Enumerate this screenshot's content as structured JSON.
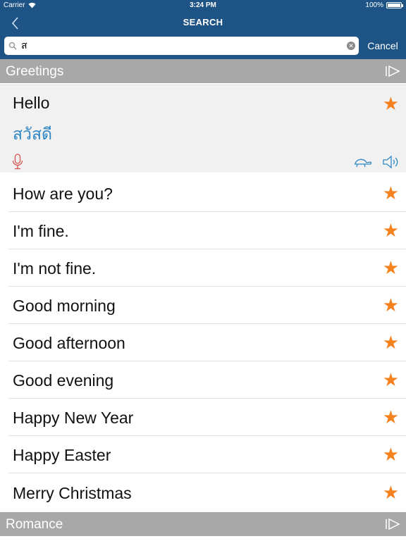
{
  "status": {
    "carrier": "Carrier",
    "time": "3:24 PM",
    "battery": "100%"
  },
  "nav": {
    "title": "SEARCH",
    "back_icon": "chevron-left-icon"
  },
  "search": {
    "value": "ส",
    "placeholder": "",
    "cancel_label": "Cancel"
  },
  "sections": [
    {
      "title": "Greetings"
    },
    {
      "title": "Romance"
    }
  ],
  "expanded": {
    "phrase": "Hello",
    "translation": "สวัสดี",
    "favorite": "★"
  },
  "phrases": [
    {
      "label": "How are you?",
      "favorite": "★"
    },
    {
      "label": "I'm fine.",
      "favorite": "★"
    },
    {
      "label": "I'm not fine.",
      "favorite": "★"
    },
    {
      "label": "Good morning",
      "favorite": "★"
    },
    {
      "label": "Good afternoon",
      "favorite": "★"
    },
    {
      "label": "Good evening",
      "favorite": "★"
    },
    {
      "label": "Happy New Year",
      "favorite": "★"
    },
    {
      "label": "Happy Easter",
      "favorite": "★"
    },
    {
      "label": "Merry Christmas",
      "favorite": "★"
    }
  ],
  "colors": {
    "nav_bar": "#1e5485",
    "section_header": "#a8a8a8",
    "star": "#f5821f",
    "translation": "#2f86c4",
    "mic": "#d9534f"
  }
}
